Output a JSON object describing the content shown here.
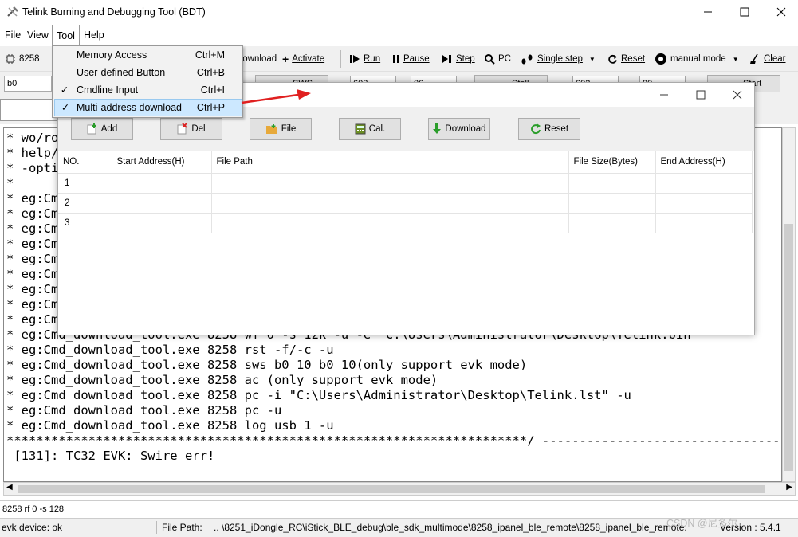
{
  "window": {
    "title": "Telink Burning and Debugging Tool (BDT)"
  },
  "menubar": {
    "items": [
      "File",
      "View",
      "Tool",
      "Help"
    ]
  },
  "toolbar": {
    "chip": "8258",
    "download": "Download",
    "activate": "Activate",
    "run": "Run",
    "pause": "Pause",
    "step": "Step",
    "pc": "PC",
    "single_step": "Single step",
    "reset": "Reset",
    "mode": "manual mode",
    "clear": "Clear"
  },
  "row2": {
    "addr": "b0",
    "sws": "SWS",
    "val1": "602",
    "val2": "06",
    "stall": "Stall",
    "val3": "602",
    "val4": "80",
    "start": "Start"
  },
  "tool_menu": {
    "items": [
      {
        "label": "Memory Access",
        "shortcut": "Ctrl+M",
        "checked": false
      },
      {
        "label": "User-defined Button",
        "shortcut": "Ctrl+B",
        "checked": false
      },
      {
        "label": "Cmdline Input",
        "shortcut": "Ctrl+I",
        "checked": true
      },
      {
        "label": "Multi-address download",
        "shortcut": "Ctrl+P",
        "checked": true
      }
    ]
  },
  "dialog": {
    "buttons": {
      "add": "Add",
      "del": "Del",
      "file": "File",
      "cal": "Cal.",
      "download": "Download",
      "reset": "Reset"
    },
    "table": {
      "headers": [
        "NO.",
        "Start Address(H)",
        "File Path",
        "File Size(Bytes)",
        "End Address(H)"
      ],
      "rows": [
        {
          "no": "1"
        },
        {
          "no": "2"
        },
        {
          "no": "3"
        }
      ]
    }
  },
  "log": {
    "lines": [
      "* wo/ro",
      "* help/",
      "* -opti",
      "*",
      "* eg:Cm",
      "* eg:Cm",
      "* eg:Cm",
      "* eg:Cm",
      "* eg:Cm",
      "* eg:Cm",
      "* eg:Cm",
      "* eg:Cm",
      "* eg:Cm",
      "* eg:Cmd_download_tool.exe 8258 wf 0 -s 12k -u -e \"C:\\Users\\Administrator\\Desktop\\Telink.bin\"",
      "* eg:Cmd_download_tool.exe 8258 rst -f/-c -u",
      "* eg:Cmd_download_tool.exe 8258 sws b0 10 b0 10(only support evk mode)",
      "* eg:Cmd_download_tool.exe 8258 ac (only support evk mode)",
      "* eg:Cmd_download_tool.exe 8258 pc -i \"C:\\Users\\Administrator\\Desktop\\Telink.lst\" -u",
      "* eg:Cmd_download_tool.exe 8258 pc -u",
      "* eg:Cmd_download_tool.exe 8258 log usb 1 -u",
      "**********************************************************************/ ------------------------------------------",
      " [131]: TC32 EVK: Swire err!"
    ]
  },
  "cmdline": "8258 rf 0 -s 128",
  "status": {
    "device": "evk device: ok",
    "file_path_label": "File Path:",
    "file_path": "..  \\8251_iDongle_RC\\iStick_BLE_debug\\ble_sdk_multimode\\8258_ipanel_ble_remote\\8258_ipanel_ble_remote.",
    "version": "Version : 5.4.1"
  },
  "watermark": "CSDN @尼多尔"
}
